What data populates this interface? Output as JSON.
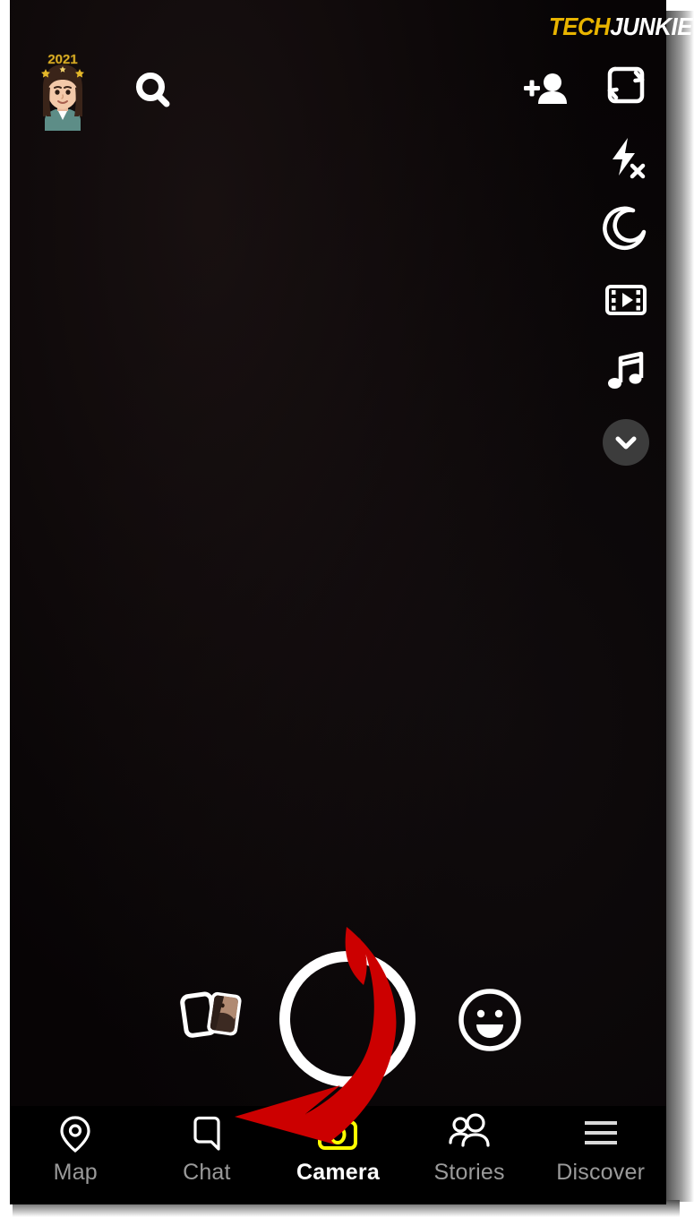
{
  "watermark": {
    "part1": "TECH",
    "part2": "JUNKIE",
    "color1": "#e8b400",
    "color2": "#ffffff"
  },
  "screen": {
    "background": "#070405",
    "app": "Snapchat Camera"
  },
  "topbar": {
    "avatar": {
      "name": "bitmoji-avatar",
      "headband_text": "2021"
    },
    "search": {
      "name": "search-icon",
      "label": "Search"
    },
    "add_friend": {
      "name": "add-friend-icon",
      "label": "Add Friend"
    }
  },
  "right_rail": {
    "items": [
      {
        "name": "camera-flip-icon",
        "label": "Flip Camera"
      },
      {
        "name": "flash-off-icon",
        "label": "Flash Off"
      },
      {
        "name": "night-mode-icon",
        "label": "Night Mode"
      },
      {
        "name": "multi-snap-icon",
        "label": "Multi Snap"
      },
      {
        "name": "music-icon",
        "label": "Sounds"
      },
      {
        "name": "chevron-down-icon",
        "label": "More Options"
      }
    ],
    "chevron_bg": "#3c3c3c"
  },
  "capture": {
    "memories": {
      "name": "memories-icon",
      "label": "Memories"
    },
    "shutter": {
      "name": "capture-button",
      "label": "Capture",
      "ring_color": "#ffffff"
    },
    "lens": {
      "name": "lens-smiley-icon",
      "label": "Lenses"
    }
  },
  "annotation": {
    "arrow": {
      "name": "red-arrow-annotation",
      "color": "#cc0000",
      "points_to": "Chat"
    }
  },
  "bottom_nav": {
    "active": "Camera",
    "inactive_color": "#9a9a9a",
    "active_color": "#ffffff",
    "camera_accent": "#ffff00",
    "items": [
      {
        "label": "Map",
        "icon": "map-pin-icon"
      },
      {
        "label": "Chat",
        "icon": "chat-bubble-icon"
      },
      {
        "label": "Camera",
        "icon": "camera-icon"
      },
      {
        "label": "Stories",
        "icon": "people-icon"
      },
      {
        "label": "Discover",
        "icon": "hamburger-icon"
      }
    ]
  }
}
